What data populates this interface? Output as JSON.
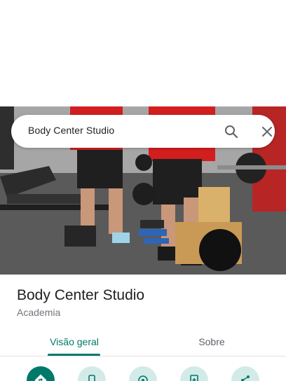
{
  "search": {
    "query": "Body Center Studio"
  },
  "place": {
    "title": "Body Center Studio",
    "category": "Academia"
  },
  "tabs": [
    {
      "label": "Visão geral",
      "active": true
    },
    {
      "label": "Sobre",
      "active": false
    }
  ],
  "actions": [
    {
      "icon": "directions-icon"
    },
    {
      "icon": "phone-icon"
    },
    {
      "icon": "location-icon"
    },
    {
      "icon": "save-icon"
    },
    {
      "icon": "share-icon"
    }
  ],
  "colors": {
    "accent": "#00796b",
    "accent_light": "#d3ebe8",
    "text_primary": "#202124",
    "text_secondary": "#70757a"
  }
}
